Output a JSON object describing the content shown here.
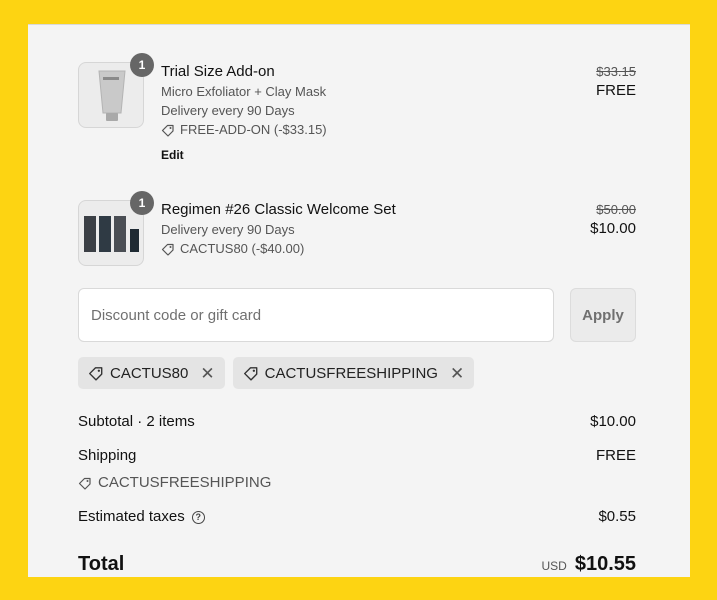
{
  "items": [
    {
      "quantity": "1",
      "title": "Trial Size Add-on",
      "variant": "Micro Exfoliator + Clay Mask",
      "delivery": "Delivery every 90 Days",
      "discount": "FREE-ADD-ON (-$33.15)",
      "edit": "Edit",
      "price_original": "$33.15",
      "price_final": "FREE"
    },
    {
      "quantity": "1",
      "title": "Regimen #26 Classic Welcome Set",
      "delivery": "Delivery every 90 Days",
      "discount": "CACTUS80 (-$40.00)",
      "price_original": "$50.00",
      "price_final": "$10.00"
    }
  ],
  "discount": {
    "placeholder": "Discount code or gift card",
    "apply_label": "Apply"
  },
  "applied_codes": [
    "CACTUS80",
    "CACTUSFREESHIPPING"
  ],
  "summary": {
    "subtotal_label": "Subtotal · 2 items",
    "subtotal_value": "$10.00",
    "shipping_label": "Shipping",
    "shipping_value": "FREE",
    "shipping_code": "CACTUSFREESHIPPING",
    "taxes_label": "Estimated taxes",
    "taxes_value": "$0.55",
    "total_label": "Total",
    "currency": "USD",
    "total_value": "$10.55"
  },
  "colors": {
    "frame": "#FDD412",
    "panel": "#F4F4F4",
    "badge": "#666666"
  }
}
